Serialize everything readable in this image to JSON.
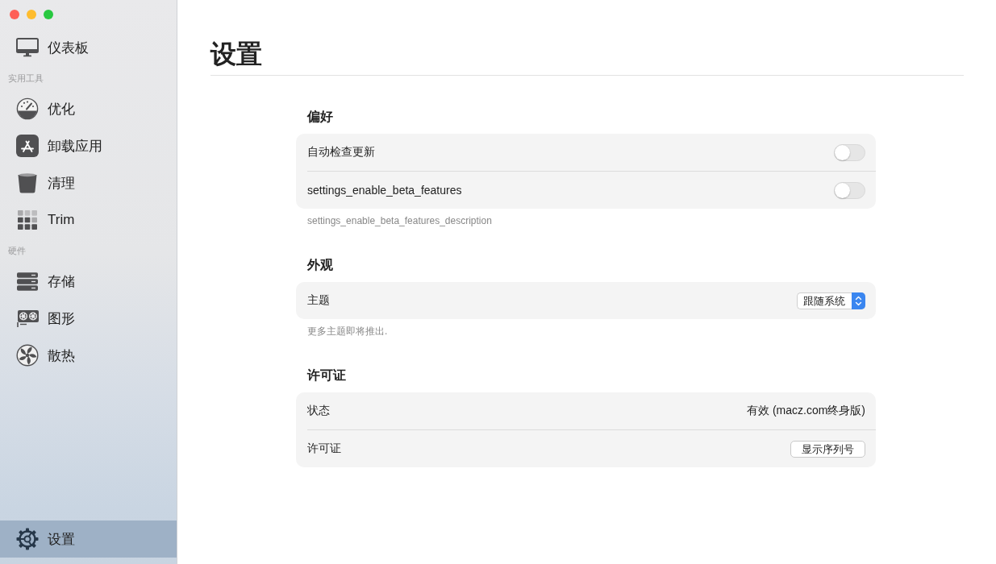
{
  "sidebar": {
    "sections": [
      {
        "items": [
          {
            "label": "仪表板",
            "selected": false
          }
        ]
      },
      {
        "heading": "实用工具",
        "items": [
          {
            "label": "优化",
            "selected": false
          },
          {
            "label": "卸载应用",
            "selected": false
          },
          {
            "label": "清理",
            "selected": false
          },
          {
            "label": "Trim",
            "selected": false
          }
        ]
      },
      {
        "heading": "硬件",
        "items": [
          {
            "label": "存储",
            "selected": false
          },
          {
            "label": "图形",
            "selected": false
          },
          {
            "label": "散热",
            "selected": false
          }
        ]
      }
    ],
    "footer_item": {
      "label": "设置",
      "selected": true
    }
  },
  "page": {
    "title": "设置"
  },
  "groups": [
    {
      "heading": "偏好",
      "rows": [
        {
          "kind": "toggle",
          "label": "自动检查更新",
          "on": false
        },
        {
          "kind": "toggle",
          "label": "settings_enable_beta_features",
          "on": false
        }
      ],
      "note": "settings_enable_beta_features_description"
    },
    {
      "heading": "外观",
      "rows": [
        {
          "kind": "select",
          "label": "主题",
          "value": "跟随系统"
        }
      ],
      "note": "更多主题即将推出."
    },
    {
      "heading": "许可证",
      "rows": [
        {
          "kind": "text",
          "label": "状态",
          "value": "有效 (macz.com终身版)"
        },
        {
          "kind": "button",
          "label": "许可证",
          "button": "显示序列号"
        }
      ]
    }
  ]
}
